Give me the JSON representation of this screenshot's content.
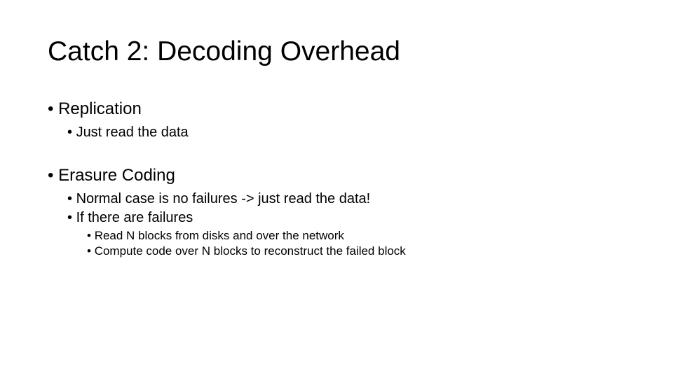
{
  "title": "Catch 2: Decoding Overhead",
  "sections": [
    {
      "heading": "Replication",
      "items": [
        {
          "text": "Just read the data",
          "children": []
        }
      ]
    },
    {
      "heading": "Erasure Coding",
      "items": [
        {
          "text": "Normal case is no failures -> just read the data!",
          "children": []
        },
        {
          "text": "If there are failures",
          "children": [
            "Read N blocks from disks and over the network",
            "Compute code over N blocks to reconstruct the failed block"
          ]
        }
      ]
    }
  ]
}
